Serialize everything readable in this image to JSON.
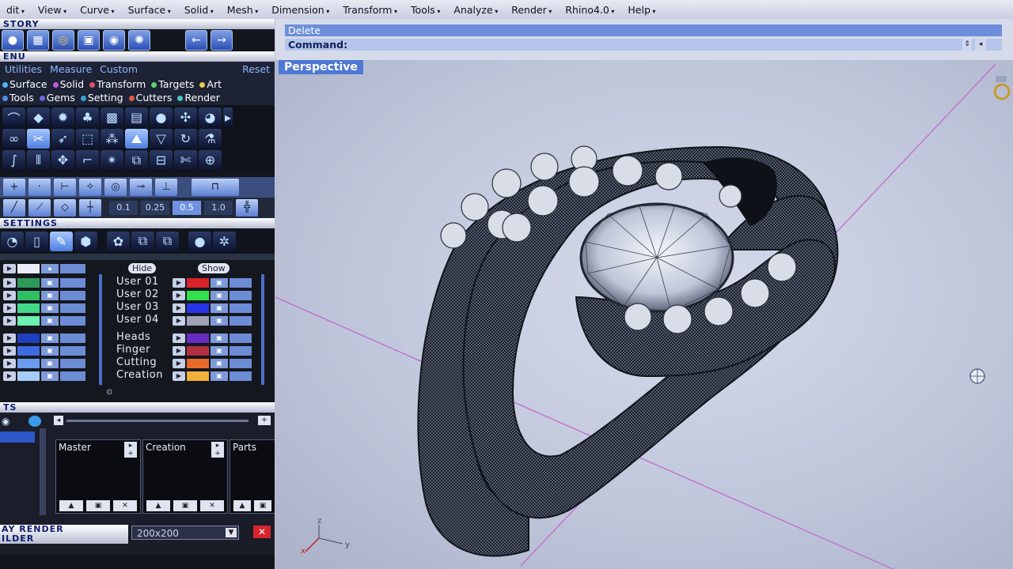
{
  "menu": [
    "dit",
    "View",
    "Curve",
    "Surface",
    "Solid",
    "Mesh",
    "Dimension",
    "Transform",
    "Tools",
    "Analyze",
    "Render",
    "Rhino4.0",
    "Help"
  ],
  "history": {
    "title": "STORY"
  },
  "jmenu": {
    "title": "ENU",
    "tabs": [
      "Utilities",
      "Measure",
      "Custom"
    ],
    "reset": "Reset",
    "categories_row1": [
      "Surface",
      "Solid",
      "Transform",
      "Targets",
      "Art"
    ],
    "categories_row2": [
      "Tools",
      "Gems",
      "Setting",
      "Cutters",
      "Render"
    ]
  },
  "snap": {
    "values": [
      "0.1",
      "0.25",
      "0.5",
      "1.0"
    ],
    "active_value": "0.5"
  },
  "settings": {
    "title": "SETTINGS"
  },
  "layers": {
    "hide_label": "Hide",
    "show_label": "Show",
    "users": [
      "User 01",
      "User 02",
      "User 03",
      "User 04"
    ],
    "groups": [
      "Heads",
      "Finger",
      "Cutting",
      "Creation"
    ]
  },
  "parts": {
    "title": "TS",
    "columns": [
      "Master",
      "Creation",
      "Parts"
    ]
  },
  "render": {
    "title1": "AY RENDER",
    "title2": "ILDER",
    "size": "200x200"
  },
  "command": {
    "history_line": "Delete",
    "prompt": "Command:"
  },
  "viewport": {
    "title": "Perspective",
    "axis_labels": {
      "x": "x",
      "y": "y",
      "z": "z"
    }
  },
  "colors": {
    "viewport_bg": "#c6cbdd",
    "title_bar": "#4f78d4",
    "panel_bg": "#14161e",
    "mesh": "#1b1f2a"
  }
}
